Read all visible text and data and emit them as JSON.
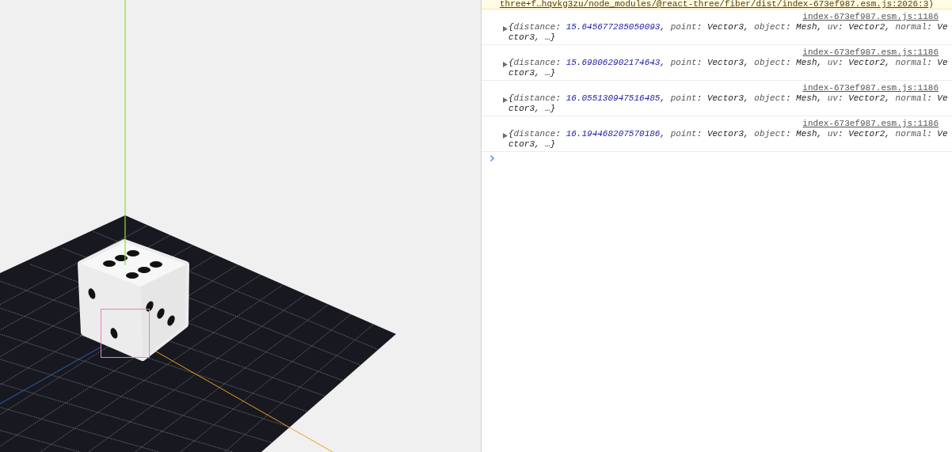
{
  "scene": {
    "selection_box": true
  },
  "console": {
    "warning_tail": {
      "link": "three+f…hqvkg3zu/node_modules/@react-three/fiber/dist/index-673ef987.esm.js:2026:3",
      "suffix": ")"
    },
    "entries": [
      {
        "source": "index-673ef987.esm.js:1186",
        "expanded": false,
        "tokens": [
          {
            "text": "{",
            "kind": "punct"
          },
          {
            "text": "distance",
            "kind": "key"
          },
          {
            "text": ": ",
            "kind": "punct"
          },
          {
            "text": "15.645677285050093",
            "kind": "number"
          },
          {
            "text": ", ",
            "kind": "punct"
          },
          {
            "text": "point",
            "kind": "key"
          },
          {
            "text": ": ",
            "kind": "punct"
          },
          {
            "text": "Vector3",
            "kind": "object"
          },
          {
            "text": ", ",
            "kind": "punct"
          },
          {
            "text": "object",
            "kind": "key"
          },
          {
            "text": ": ",
            "kind": "punct"
          },
          {
            "text": "Mesh",
            "kind": "object"
          },
          {
            "text": ", ",
            "kind": "punct"
          },
          {
            "text": "uv",
            "kind": "key"
          },
          {
            "text": ": ",
            "kind": "punct"
          },
          {
            "text": "Vector2",
            "kind": "object"
          },
          {
            "text": ", ",
            "kind": "punct"
          },
          {
            "text": "normal",
            "kind": "key"
          },
          {
            "text": ": ",
            "kind": "punct"
          },
          {
            "text": "Vector3",
            "kind": "object"
          },
          {
            "text": ", …}",
            "kind": "punct"
          }
        ]
      },
      {
        "source": "index-673ef987.esm.js:1186",
        "expanded": false,
        "tokens": [
          {
            "text": "{",
            "kind": "punct"
          },
          {
            "text": "distance",
            "kind": "key"
          },
          {
            "text": ": ",
            "kind": "punct"
          },
          {
            "text": "15.698062902174643",
            "kind": "number"
          },
          {
            "text": ", ",
            "kind": "punct"
          },
          {
            "text": "point",
            "kind": "key"
          },
          {
            "text": ": ",
            "kind": "punct"
          },
          {
            "text": "Vector3",
            "kind": "object"
          },
          {
            "text": ", ",
            "kind": "punct"
          },
          {
            "text": "object",
            "kind": "key"
          },
          {
            "text": ": ",
            "kind": "punct"
          },
          {
            "text": "Mesh",
            "kind": "object"
          },
          {
            "text": ", ",
            "kind": "punct"
          },
          {
            "text": "uv",
            "kind": "key"
          },
          {
            "text": ": ",
            "kind": "punct"
          },
          {
            "text": "Vector2",
            "kind": "object"
          },
          {
            "text": ", ",
            "kind": "punct"
          },
          {
            "text": "normal",
            "kind": "key"
          },
          {
            "text": ": ",
            "kind": "punct"
          },
          {
            "text": "Vector3",
            "kind": "object"
          },
          {
            "text": ", …}",
            "kind": "punct"
          }
        ]
      },
      {
        "source": "index-673ef987.esm.js:1186",
        "expanded": false,
        "tokens": [
          {
            "text": "{",
            "kind": "punct"
          },
          {
            "text": "distance",
            "kind": "key"
          },
          {
            "text": ": ",
            "kind": "punct"
          },
          {
            "text": "16.055130947516485",
            "kind": "number"
          },
          {
            "text": ", ",
            "kind": "punct"
          },
          {
            "text": "point",
            "kind": "key"
          },
          {
            "text": ": ",
            "kind": "punct"
          },
          {
            "text": "Vector3",
            "kind": "object"
          },
          {
            "text": ", ",
            "kind": "punct"
          },
          {
            "text": "object",
            "kind": "key"
          },
          {
            "text": ": ",
            "kind": "punct"
          },
          {
            "text": "Mesh",
            "kind": "object"
          },
          {
            "text": ", ",
            "kind": "punct"
          },
          {
            "text": "uv",
            "kind": "key"
          },
          {
            "text": ": ",
            "kind": "punct"
          },
          {
            "text": "Vector2",
            "kind": "object"
          },
          {
            "text": ", ",
            "kind": "punct"
          },
          {
            "text": "normal",
            "kind": "key"
          },
          {
            "text": ": ",
            "kind": "punct"
          },
          {
            "text": "Vector3",
            "kind": "object"
          },
          {
            "text": ", …}",
            "kind": "punct"
          }
        ]
      },
      {
        "source": "index-673ef987.esm.js:1186",
        "expanded": false,
        "tokens": [
          {
            "text": "{",
            "kind": "punct"
          },
          {
            "text": "distance",
            "kind": "key"
          },
          {
            "text": ": ",
            "kind": "punct"
          },
          {
            "text": "16.194468207570186",
            "kind": "number"
          },
          {
            "text": ", ",
            "kind": "punct"
          },
          {
            "text": "point",
            "kind": "key"
          },
          {
            "text": ": ",
            "kind": "punct"
          },
          {
            "text": "Vector3",
            "kind": "object"
          },
          {
            "text": ", ",
            "kind": "punct"
          },
          {
            "text": "object",
            "kind": "key"
          },
          {
            "text": ": ",
            "kind": "punct"
          },
          {
            "text": "Mesh",
            "kind": "object"
          },
          {
            "text": ", ",
            "kind": "punct"
          },
          {
            "text": "uv",
            "kind": "key"
          },
          {
            "text": ": ",
            "kind": "punct"
          },
          {
            "text": "Vector2",
            "kind": "object"
          },
          {
            "text": ", ",
            "kind": "punct"
          },
          {
            "text": "normal",
            "kind": "key"
          },
          {
            "text": ": ",
            "kind": "punct"
          },
          {
            "text": "Vector3",
            "kind": "object"
          },
          {
            "text": ", …}",
            "kind": "punct"
          }
        ]
      }
    ]
  }
}
